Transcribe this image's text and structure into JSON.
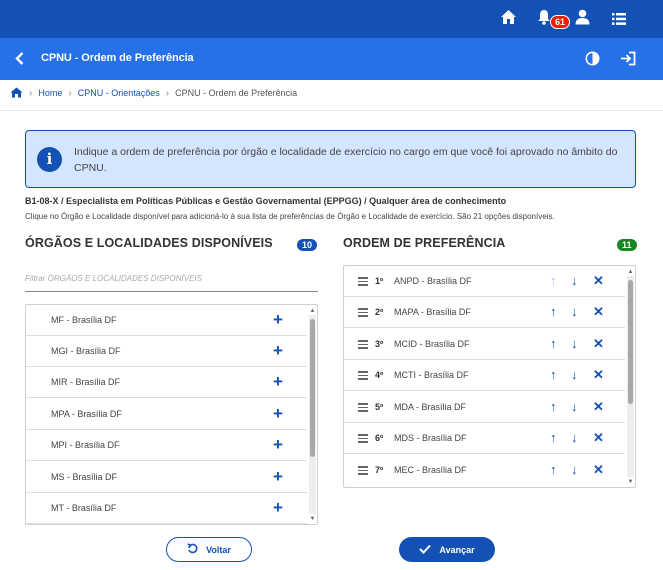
{
  "topbar": {
    "icons": [
      "home-icon",
      "bell-icon",
      "user-icon",
      "menu-list-icon"
    ],
    "notification_count": "61"
  },
  "header": {
    "title": "CPNU - Ordem de Preferência",
    "icons": [
      "back-arrow-icon",
      "contrast-icon",
      "exit-icon"
    ]
  },
  "breadcrumb": [
    "Home",
    "CPNU - Orientações",
    "CPNU - Ordem de Preferência"
  ],
  "info": {
    "text": "Indique a ordem de preferência por órgão e localidade de exercício no cargo em que você foi aprovado no âmbito do CPNU."
  },
  "cargo": "B1-08-X / Especialista em Políticas Públicas e Gestão Governamental (EPPGG) / Qualquer área de conhecimento",
  "hint": "Clique no Órgão e Localidade disponível para adicioná-lo à sua lista de preferências de Órgão e Localidade de exercício. São 21 opções disponíveis.",
  "available": {
    "title": "ÓRGÃOS E LOCALIDADES DISPONÍVEIS",
    "count": "10",
    "filter_placeholder": "Filtrar ÓRGÃOS E LOCALIDADES DISPONÍVEIS",
    "items": [
      "MF - Brasília DF",
      "MGI - Brasília DF",
      "MIR - Brasília DF",
      "MPA - Brasília DF",
      "MPI - Brasília DF",
      "MS - Brasília DF",
      "MT - Brasília DF"
    ]
  },
  "preference": {
    "title": "ORDEM DE PREFERÊNCIA",
    "count": "11",
    "items": [
      {
        "order": "1º",
        "label": "ANPD - Brasília DF"
      },
      {
        "order": "2º",
        "label": "MAPA - Brasília DF"
      },
      {
        "order": "3º",
        "label": "MCID - Brasília DF"
      },
      {
        "order": "4º",
        "label": "MCTI - Brasília DF"
      },
      {
        "order": "5º",
        "label": "MDA - Brasília DF"
      },
      {
        "order": "6º",
        "label": "MDS - Brasília DF"
      },
      {
        "order": "7º",
        "label": "MEC - Brasília DF"
      }
    ]
  },
  "buttons": {
    "back": "Voltar",
    "next": "Avançar"
  },
  "colors": {
    "primary": "#1351b4",
    "header": "#2670e8",
    "info_bg": "#d4e5ff",
    "badge_red": "#e52207",
    "badge_green": "#168821"
  }
}
